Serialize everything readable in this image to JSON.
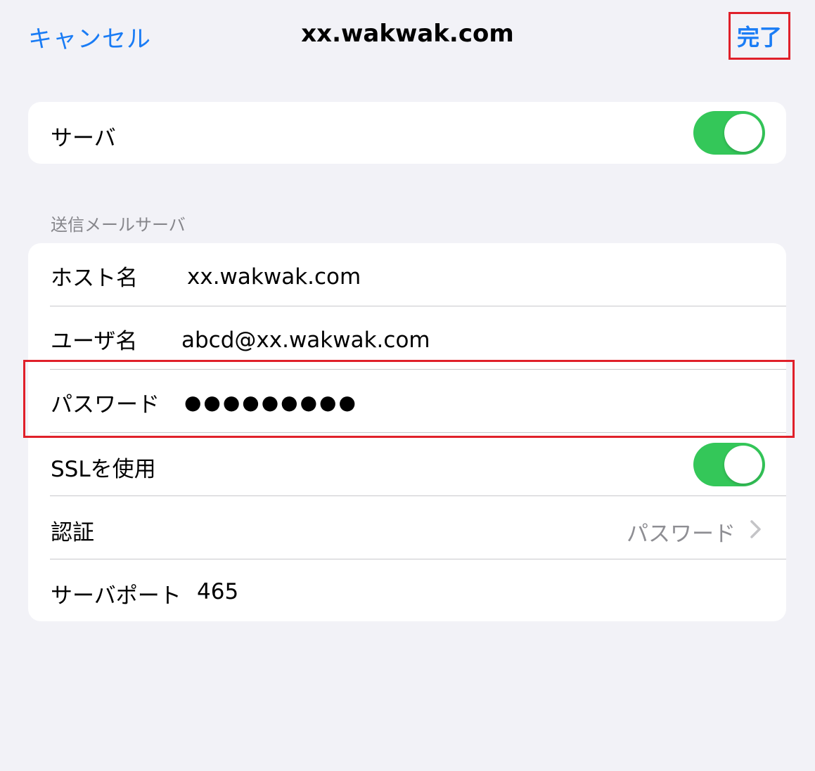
{
  "nav": {
    "cancel_label": "キャンセル",
    "title": "xx.wakwak.com",
    "done_label": "完了"
  },
  "server_card": {
    "label": "サーバ",
    "toggle_on": true
  },
  "smtp_section": {
    "header": "送信メールサーバ",
    "hostname_label": "ホスト名",
    "hostname_value": "xx.wakwak.com",
    "username_label": "ユーザ名",
    "username_value": "abcd@xx.wakwak.com",
    "password_label": "パスワード",
    "password_value": "●●●●●●●●●",
    "ssl_label": "SSLを使用",
    "ssl_toggle_on": true,
    "auth_label": "認証",
    "auth_value": "パスワード",
    "port_label": "サーバポート",
    "port_value": "465"
  },
  "colors": {
    "accent_blue": "#1a7cf5",
    "toggle_green": "#34c759",
    "highlight_red": "#e0202a",
    "background": "#f2f2f7"
  },
  "icons": {
    "auth_chevron": "chevron-right-icon"
  }
}
